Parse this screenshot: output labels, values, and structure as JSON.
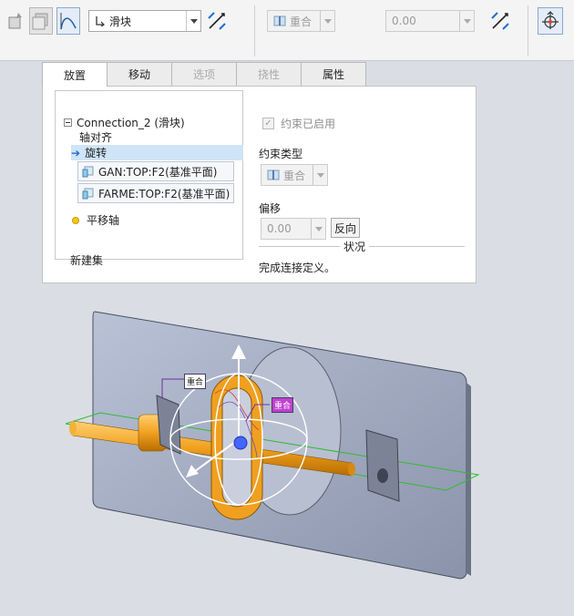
{
  "toolbar": {
    "connection_type": "滑块",
    "constraint_type": "重合",
    "offset_value": "0.00",
    "icons": [
      "user-defined-icon",
      "display-icon",
      "curve-icon",
      "flip-icon",
      "flip-icon",
      "drag-handle-icon"
    ]
  },
  "tabs": [
    {
      "label": "放置",
      "state": "selected"
    },
    {
      "label": "移动",
      "state": "normal"
    },
    {
      "label": "选项",
      "state": "disabled"
    },
    {
      "label": "挠性",
      "state": "disabled"
    },
    {
      "label": "属性",
      "state": "normal"
    }
  ],
  "tree": {
    "root": "Connection_2 (滑块)",
    "axis_align": "轴对齐",
    "rotation": "旋转",
    "ref1": "GAN:TOP:F2(基准平面)",
    "ref2": "FARME:TOP:F2(基准平面)",
    "translation_axis": "平移轴",
    "new_set": "新建集"
  },
  "options": {
    "constraint_enabled": "约束已启用",
    "constraint_type_label": "约束类型",
    "constraint_type_value": "重合",
    "offset_label": "偏移",
    "offset_value": "0.00",
    "flip_button": "反向",
    "status_title": "状况",
    "status_text": "完成连接定义。"
  },
  "viewport": {
    "tag_a": "重合",
    "tag_b": "重合"
  },
  "colors": {
    "accent": "#1c6fd1",
    "selection": "#cfe4f7",
    "part_orange": "#f0a020",
    "plate": "#a6b0c6",
    "plane_green": "#33bb33",
    "tag_magenta": "#c040d0"
  }
}
